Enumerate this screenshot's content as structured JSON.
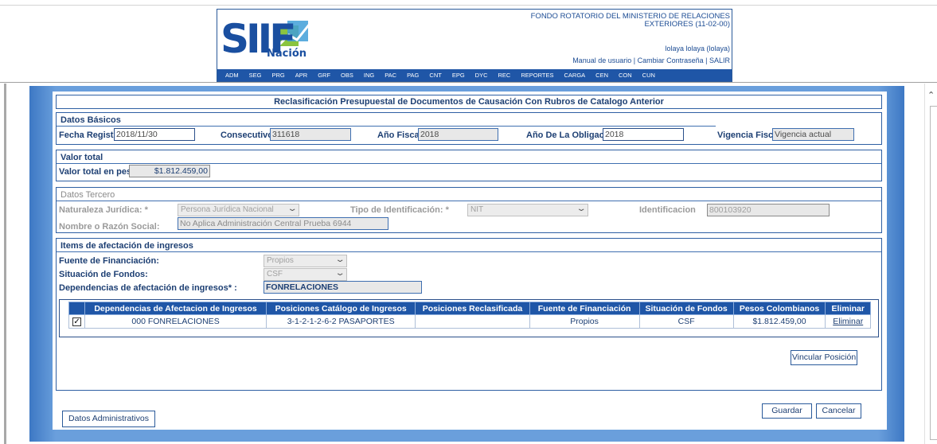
{
  "header": {
    "logo_main": "SIIF",
    "logo_sub": "Nación",
    "org_name": "FONDO ROTATORIO DEL MINISTERIO DE RELACIONES EXTERIORES (11-02-00)",
    "user": "lolaya lolaya (lolaya)",
    "links": {
      "manual": "Manual de usuario",
      "sep1": " | ",
      "change_password": "Cambiar Contraseña",
      "sep2": " | ",
      "logout": "SALIR"
    },
    "menu": [
      "ADM",
      "SEG",
      "PRG",
      "APR",
      "GRF",
      "OBS",
      "ING",
      "PAC",
      "PAG",
      "CNT",
      "EPG",
      "DYC",
      "REC",
      "REPORTES",
      "CARGA",
      "CEN",
      "CON",
      "CUN"
    ]
  },
  "form": {
    "title": "Reclasificación Presupuestal de Documentos de Causación Con Rubros de Catalogo Anterior",
    "datos_basicos": {
      "title": "Datos Básicos",
      "fecha_registro_label": "Fecha Registro:",
      "fecha_registro": "2018/11/30",
      "consecutivo_label": "Consecutivo:",
      "consecutivo": "311618",
      "anio_fiscal_label": "Año Fiscal:",
      "anio_fiscal": "2018",
      "anio_obligacion_label": "Año De La Obligacion:",
      "anio_obligacion": "2018",
      "vigencia_label": "Vigencia Fiscal:",
      "vigencia": "Vigencia actual"
    },
    "valor_total": {
      "title": "Valor total",
      "label": "Valor total en pesos",
      "value": "$1.812.459,00"
    },
    "datos_tercero": {
      "title": "Datos Tercero",
      "naturaleza_label": "Naturaleza Jurídica: *",
      "naturaleza": "Persona Jurídica Nacional",
      "tipo_id_label": "Tipo de Identificación: *",
      "tipo_id": "NIT",
      "identificacion_label": "Identificacion",
      "identificacion": "800103920",
      "nombre_label": "Nombre o Razón Social:",
      "nombre": "No Aplica Administración Central Prueba 6944"
    },
    "items": {
      "title": "Items de afectación de ingresos",
      "fuente_label": "Fuente de Financiación:",
      "fuente": "Propios",
      "situacion_label": "Situación de Fondos:",
      "situacion": "CSF",
      "dependencias_label": "Dependencias de afectación de ingresos* :",
      "dependencias": "FONRELACIONES"
    },
    "grid": {
      "headers": [
        "",
        "Dependencias de Afectacion de Ingresos",
        "Posiciones Catálogo de Ingresos",
        "Posiciones Reclasificada",
        "Fuente de Financiación",
        "Situación de Fondos",
        "Pesos Colombianos",
        "Eliminar"
      ],
      "rows": [
        {
          "checked": "✓",
          "dependencia": "000 FONRELACIONES",
          "posicion": "3-1-2-1-2-6-2 PASAPORTES",
          "reclasificada": "",
          "fuente": "Propios",
          "situacion": "CSF",
          "pesos": "$1.812.459,00",
          "eliminar": "Eliminar"
        }
      ]
    },
    "buttons": {
      "vincular": "Vincular Posición",
      "datos_admin": "Datos Administrativos",
      "guardar": "Guardar",
      "cancelar": "Cancelar"
    }
  },
  "colors": {
    "brand_blue": "#1f56a7",
    "frame_blue": "#6a9fdc",
    "text_navy": "#1d3f73"
  },
  "icons": {
    "dropdown": "chevron-down-icon",
    "scroll_up": "caret-up-icon",
    "check": "check-icon"
  }
}
